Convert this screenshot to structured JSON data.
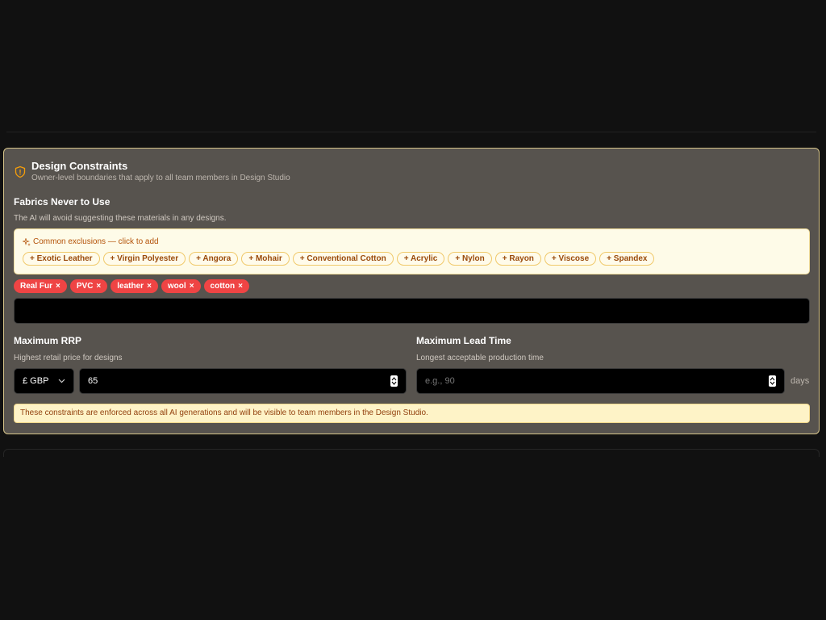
{
  "card": {
    "title": "Design Constraints",
    "subtitle": "Owner-level boundaries that apply to all team members in Design Studio"
  },
  "fabrics": {
    "title": "Fabrics Never to Use",
    "description": "The AI will avoid suggesting these materials in any designs.",
    "suggestions_heading": "Common exclusions — click to add",
    "suggestions": [
      "+ Exotic Leather",
      "+ Virgin Polyester",
      "+ Angora",
      "+ Mohair",
      "+ Conventional Cotton",
      "+ Acrylic",
      "+ Nylon",
      "+ Rayon",
      "+ Viscose",
      "+ Spandex"
    ],
    "tags": [
      "Real Fur",
      "PVC",
      "leather",
      "wool",
      "cotton"
    ],
    "remove_glyph": "×",
    "input_value": ""
  },
  "rrp": {
    "label": "Maximum RRP",
    "description": "Highest retail price for designs",
    "currency": "£ GBP",
    "value": "65"
  },
  "lead_time": {
    "label": "Maximum Lead Time",
    "description": "Longest acceptable production time",
    "placeholder": "e.g., 90",
    "unit": "days"
  },
  "notice": "These constraints are enforced across all AI generations and will be visible to team members in the Design Studio.",
  "colors": {
    "background": "#111111",
    "card": "#57534e",
    "card_border": "#d6c48a",
    "tag": "#ef4444",
    "accent": "#b45309"
  }
}
